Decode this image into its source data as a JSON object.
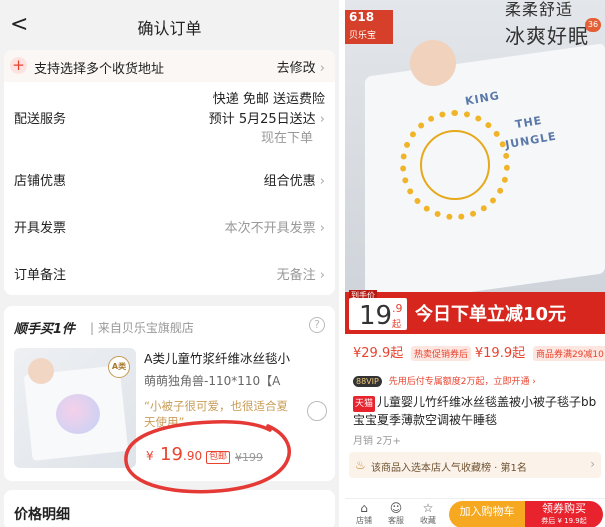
{
  "left": {
    "nav": {
      "back_glyph": "<",
      "title": "确认订单"
    },
    "address": {
      "plus_glyph": "+",
      "label": "支持选择多个收货地址",
      "action": "去修改"
    },
    "delivery": {
      "label": "配送服务",
      "line1": "快递 免邮 送运费险",
      "line2": "预计 5月25日送达",
      "line3": "现在下单"
    },
    "discount": {
      "label": "店铺优惠",
      "value": "组合优惠"
    },
    "invoice": {
      "label": "开具发票",
      "value": "本次不开具发票"
    },
    "remark": {
      "label": "订单备注",
      "value": "无备注"
    },
    "shop": {
      "title": "顺手买1件",
      "from": "来自贝乐宝旗舰店",
      "help_glyph": "?"
    },
    "product": {
      "badge": "A类",
      "name": "A类儿童竹浆纤维冰丝毯小",
      "spec": "萌萌独角兽-110*110【A",
      "desc": "“小被子很可爱，也很适合夏天使用”",
      "currency": "¥",
      "price_int": "19",
      "price_dec": ".90",
      "tag": "包邮",
      "old_price": "¥199"
    },
    "price_detail": {
      "title": "价格明细"
    }
  },
  "right": {
    "brand_tag": {
      "line1": "618",
      "line2": "贝乐宝"
    },
    "image_count": "36",
    "slogan": {
      "line1": "柔柔舒适",
      "line2": "冰爽好眠"
    },
    "blanket_words": [
      "KING",
      "JUNGLE",
      "THE"
    ],
    "promo": {
      "small": "到手价",
      "price_int": "19",
      "price_dec": ".9",
      "price_unit": "起",
      "text": "今日下单立减10元"
    },
    "prices": {
      "original": "¥29.9起",
      "pill1": "热卖促销券后",
      "after": "¥19.9起",
      "pill2": "商品券满29减10"
    },
    "vip": {
      "badge": "88VIP",
      "text": "先用后付专属额度2万起，立即开通 ›"
    },
    "title": {
      "tmall": "天猫",
      "text": "儿童婴儿竹纤维冰丝毯盖被小被子毯子bb宝宝夏季薄款空调被午睡毯"
    },
    "sold": "月销 2万+",
    "rank": {
      "icon": "♨",
      "text": "该商品入选本店人气收藏榜 · 第1名"
    },
    "bottom": {
      "shop": "店铺",
      "service": "客服",
      "fav": "收藏",
      "cart": "加入购物车",
      "buy": "领券购买",
      "buy_sub": "券后 ¥ 19.9起"
    }
  }
}
